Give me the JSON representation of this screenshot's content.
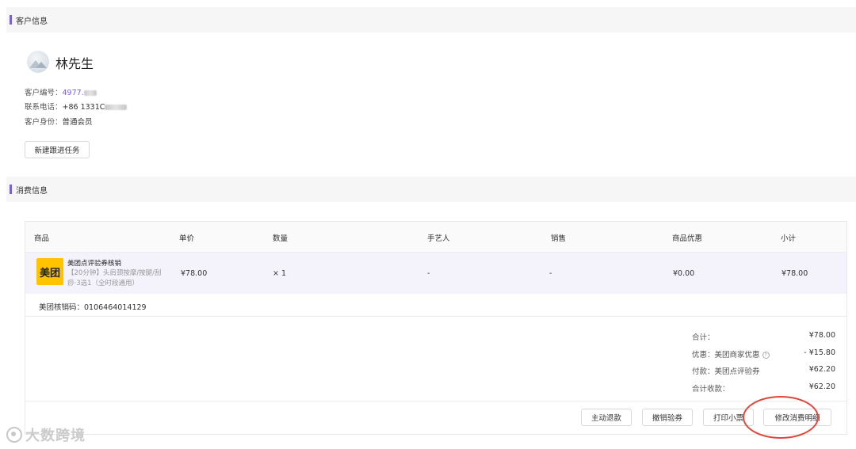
{
  "customer_section": {
    "title": "客户信息",
    "name": "林先生",
    "id_label": "客户编号：",
    "id_value": "4977.",
    "phone_label": "联系电话：",
    "phone_value": "+86 1331C",
    "identity_label": "客户身份：",
    "identity_value": "普通会员",
    "new_task_button": "新建跟进任务"
  },
  "consumption_section": {
    "title": "消费信息",
    "columns": [
      "商品",
      "单价",
      "数量",
      "手艺人",
      "销售",
      "商品优惠",
      "小计"
    ],
    "item": {
      "logo": "美团",
      "title": "美团点评验券核销",
      "description": "【20分钟】头肩颈按摩/按腿/刮痧·3选1（全时段通用）",
      "unit_price": "¥78.00",
      "quantity": "× 1",
      "artisan": "-",
      "sales": "-",
      "discount": "¥0.00",
      "subtotal": "¥78.00"
    },
    "verify_code": "美团核销码：0106464014129",
    "summary": [
      {
        "label": "合计：",
        "value": "¥78.00"
      },
      {
        "label": "优惠：美团商家优惠",
        "value": "- ¥15.80"
      },
      {
        "label": "付款：美团点评验券",
        "value": "¥62.20"
      },
      {
        "label": "合计收款：",
        "value": "¥62.20"
      }
    ],
    "actions": {
      "refund": "主动退款",
      "revoke": "撤销验券",
      "print": "打印小票",
      "modify": "修改消费明细"
    }
  },
  "watermark": "大数跨境",
  "colors": {
    "accent": "#7b61d8",
    "highlight_circle": "#e2463b",
    "meituan_yellow": "#ffc300"
  }
}
